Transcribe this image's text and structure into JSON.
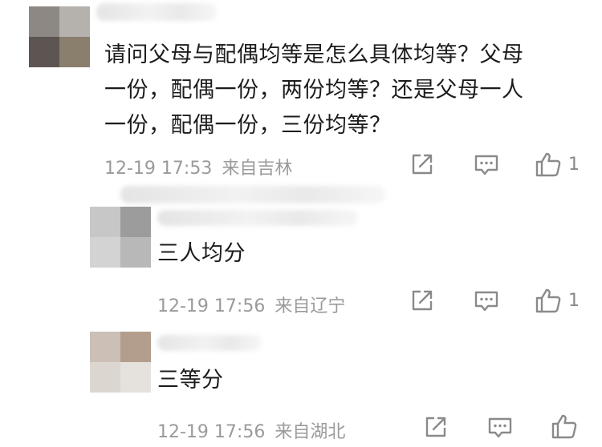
{
  "comments": [
    {
      "text": "请问父母与配偶均等是怎么具体均等？父母\n一份，配偶一份，两份均等？还是父母一人\n一份，配偶一份，三份均等？",
      "time": "12-19 17:53",
      "location": "来自吉林",
      "like_count": "1",
      "icons": [
        "share-icon",
        "comment-icon",
        "thumbs-up-icon"
      ]
    },
    {
      "text": "三人均分",
      "time": "12-19 17:56",
      "location": "来自辽宁",
      "like_count": "1",
      "icons": [
        "share-icon",
        "comment-icon",
        "thumbs-up-icon"
      ]
    },
    {
      "text": "三等分",
      "time": "12-19 17:56",
      "location": "来自湖北",
      "like_count": "",
      "icons": [
        "share-icon",
        "comment-icon",
        "thumbs-up-icon"
      ]
    }
  ],
  "colors": {
    "text": "#1c1c1c",
    "meta": "#9a9a9a",
    "icon": "#8a8a8a",
    "background": "#ffffff"
  }
}
